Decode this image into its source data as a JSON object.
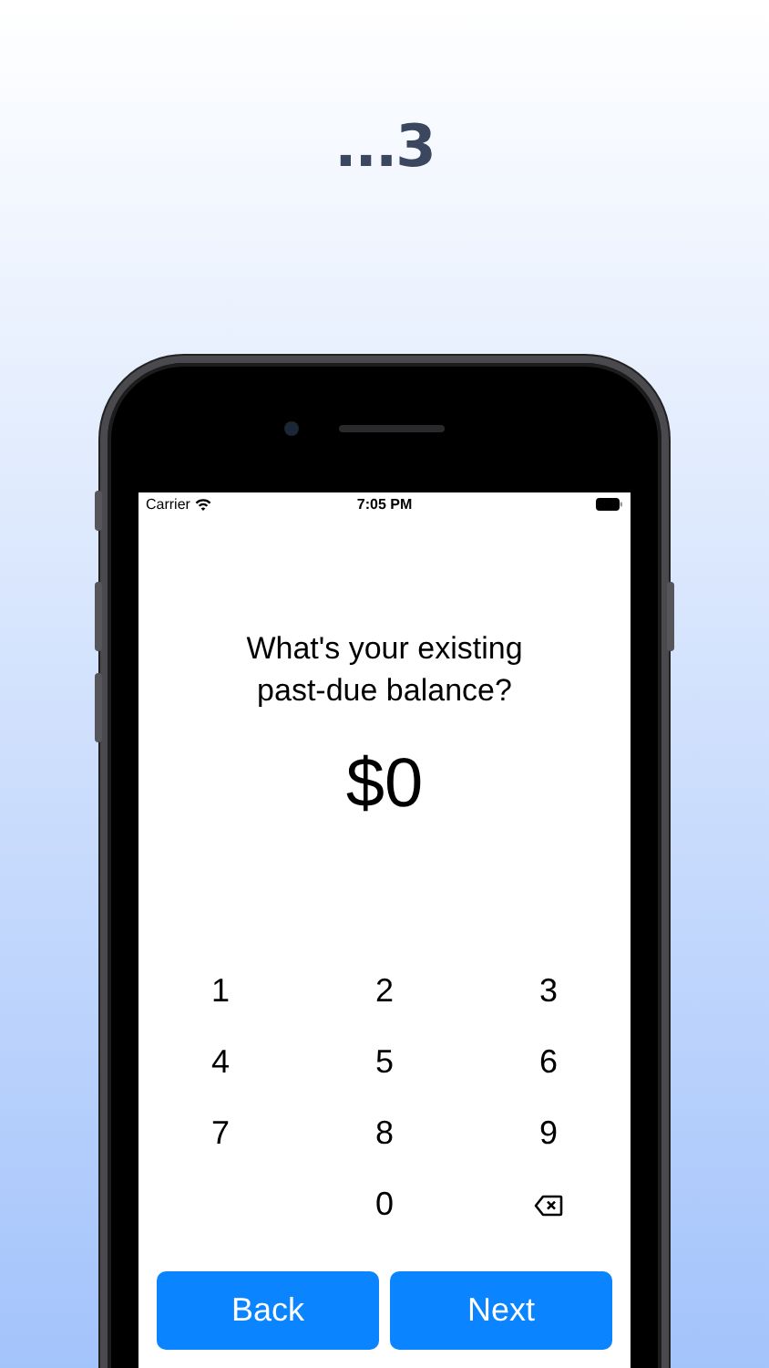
{
  "heading": "...3",
  "status_bar": {
    "carrier": "Carrier",
    "time": "7:05 PM"
  },
  "question": "What's your existing past-due balance?",
  "amount": "$0",
  "keypad": [
    {
      "kind": "digit",
      "label": "1"
    },
    {
      "kind": "digit",
      "label": "2"
    },
    {
      "kind": "digit",
      "label": "3"
    },
    {
      "kind": "digit",
      "label": "4"
    },
    {
      "kind": "digit",
      "label": "5"
    },
    {
      "kind": "digit",
      "label": "6"
    },
    {
      "kind": "digit",
      "label": "7"
    },
    {
      "kind": "digit",
      "label": "8"
    },
    {
      "kind": "digit",
      "label": "9"
    },
    {
      "kind": "blank"
    },
    {
      "kind": "digit",
      "label": "0"
    },
    {
      "kind": "backspace"
    }
  ],
  "buttons": [
    "Back",
    "Next"
  ]
}
